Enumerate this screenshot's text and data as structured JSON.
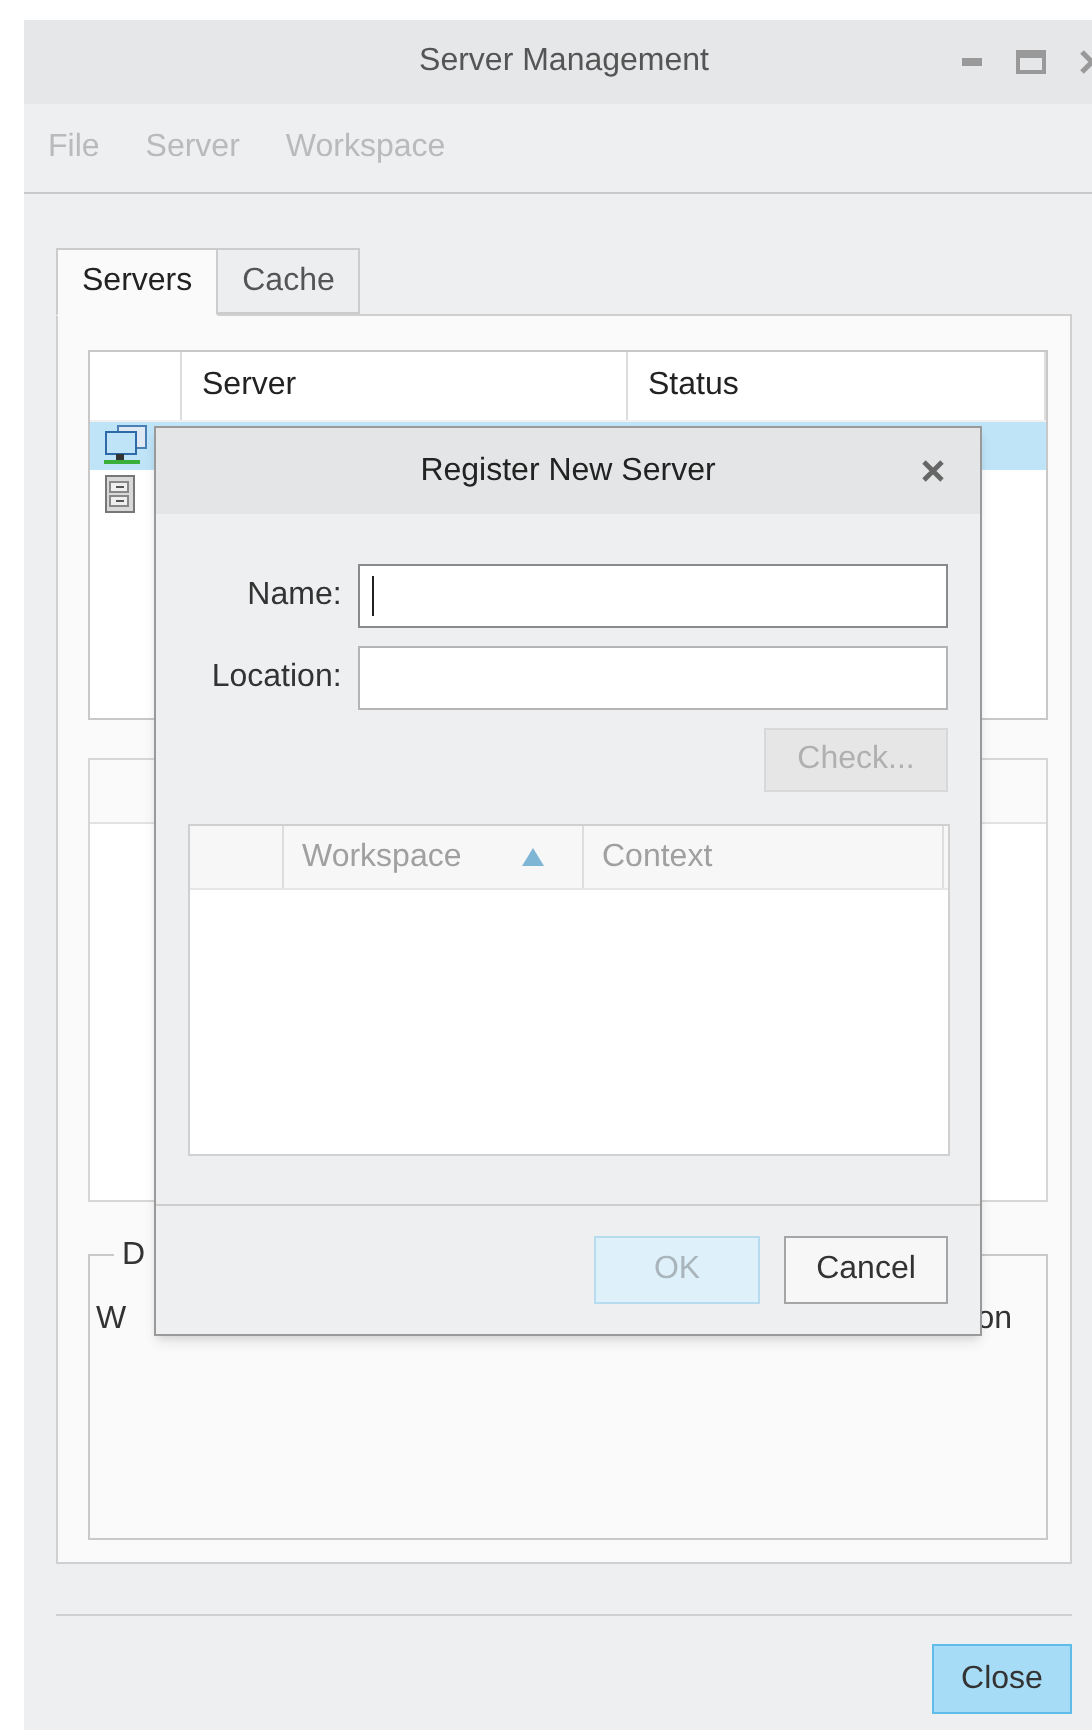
{
  "window": {
    "title": "Server Management"
  },
  "menu": [
    {
      "label": "File",
      "disabled": true
    },
    {
      "label": "Server",
      "disabled": true
    },
    {
      "label": "Workspace",
      "disabled": true
    }
  ],
  "tabs": [
    {
      "label": "Servers",
      "selected": true
    },
    {
      "label": "Cache",
      "selected": false
    }
  ],
  "servers_table": {
    "columns": [
      "Server",
      "Status"
    ],
    "rows": [
      {
        "kind": "network",
        "selected": true
      },
      {
        "kind": "cabinet",
        "selected": false
      }
    ]
  },
  "group": {
    "title": "D",
    "line_start": "W",
    "line_end": "on"
  },
  "dialog": {
    "title": "Register New Server",
    "fields": [
      {
        "label": "Name:",
        "focused": true
      },
      {
        "label": "Location:",
        "focused": false
      }
    ],
    "check_button": {
      "label": "Check...",
      "disabled": true
    },
    "workspace_table": {
      "columns": [
        {
          "label": "Workspace",
          "sorted": true
        },
        {
          "label": "Context",
          "sorted": false
        }
      ]
    },
    "buttons": [
      {
        "label": "OK",
        "disabled": true
      },
      {
        "label": "Cancel",
        "disabled": false
      }
    ]
  },
  "close_button": {
    "label": "Close",
    "default": true
  }
}
